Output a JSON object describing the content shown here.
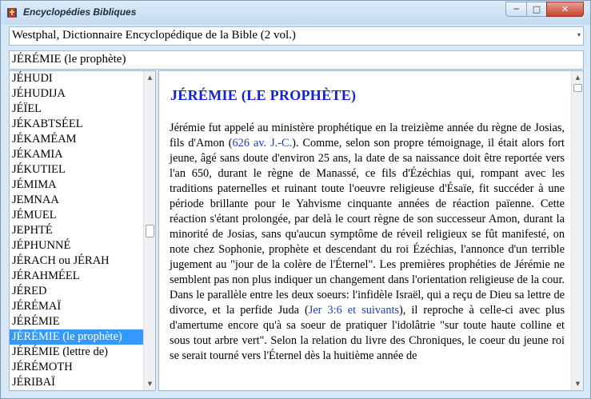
{
  "window": {
    "title": "Encyclopédies Bibliques",
    "min_label": "─",
    "max_label": "□",
    "close_label": "✕"
  },
  "dictionary": {
    "selected": "Westphal, Dictionnaire Encyclopédique de la Bible (2 vol.)",
    "arrow": "▾"
  },
  "entry": {
    "value": "JÉRÉMIE (le prophète)"
  },
  "list": {
    "items": [
      "JÉHUDI",
      "JÉHUDIJA",
      "JÉÏEL",
      "JÉKABTSÉEL",
      "JÉKAMÉAM",
      "JÉKAMIA",
      "JÉKUTIEL",
      "JÉMIMA",
      "JEMNAA",
      "JÉMUEL",
      "JEPHTÉ",
      "JÉPHUNNÉ",
      "JÉRACH ou JÉRAH",
      "JÉRAHMÉEL",
      "JÉRED",
      "JÉRÉMAÏ",
      "JÉRÉMIE",
      "JÉRÉMIE (le prophète)",
      "JÉRÉMIE (lettre de)",
      "JÉRÉMOTH",
      "JÉRIBAÏ"
    ],
    "selected_index": 17,
    "scroll_fraction": 0.5
  },
  "article": {
    "heading": "JÉRÉMIE (LE PROPHÈTE)",
    "p1": "Jérémie fut appelé au ministère prophétique en la treizième année du règne de Josias, fils d'Amon (",
    "ref1": "626 av. J.-C.",
    "p2": "). Comme, selon son propre témoignage, il était alors fort jeune, âgé sans doute d'environ 25 ans, la date de sa naissance doit être reportée vers l'an 650, durant le règne de Manassé, ce fils d'Ézéchias qui, rompant avec les traditions paternelles et ruinant toute l'oeuvre religieuse d'Ésaïe, fit succéder à une période brillante pour le Yahvisme cinquante années de réaction païenne. Cette réaction s'étant prolongée, par delà le court règne de son successeur Amon, durant la minorité de Josias, sans qu'aucun symptôme de réveil religieux se fût manifesté, on note chez Sophonie, prophète et descendant du roi Ézéchias, l'annonce d'un terrible jugement au \"jour de la colère de l'Éternel\". Les premières prophéties de Jérémie ne semblent pas non plus indiquer un changement dans l'orientation religieuse de la cour. Dans le parallèle entre les deux soeurs: l'infidèle Israël, qui a reçu de Dieu sa lettre de divorce, et la perfide Juda (",
    "ref2": "Jer 3:6 et suivants",
    "p3": "), il reproche à celle-ci avec plus d'amertume encore qu'à sa soeur de pratiquer l'idolâtrie \"sur toute haute colline et sous tout arbre vert\". Selon la relation du livre des Chroniques, le coeur du jeune roi se serait tourné vers l'Éternel dès la huitième année de",
    "scroll_fraction": 0.0
  },
  "colors": {
    "selection": "#3399ff",
    "heading": "#1020d8",
    "reference": "#1a3fc8"
  },
  "icons": {
    "app": "bible-book-icon",
    "scroll_up": "▲",
    "scroll_down": "▼"
  }
}
